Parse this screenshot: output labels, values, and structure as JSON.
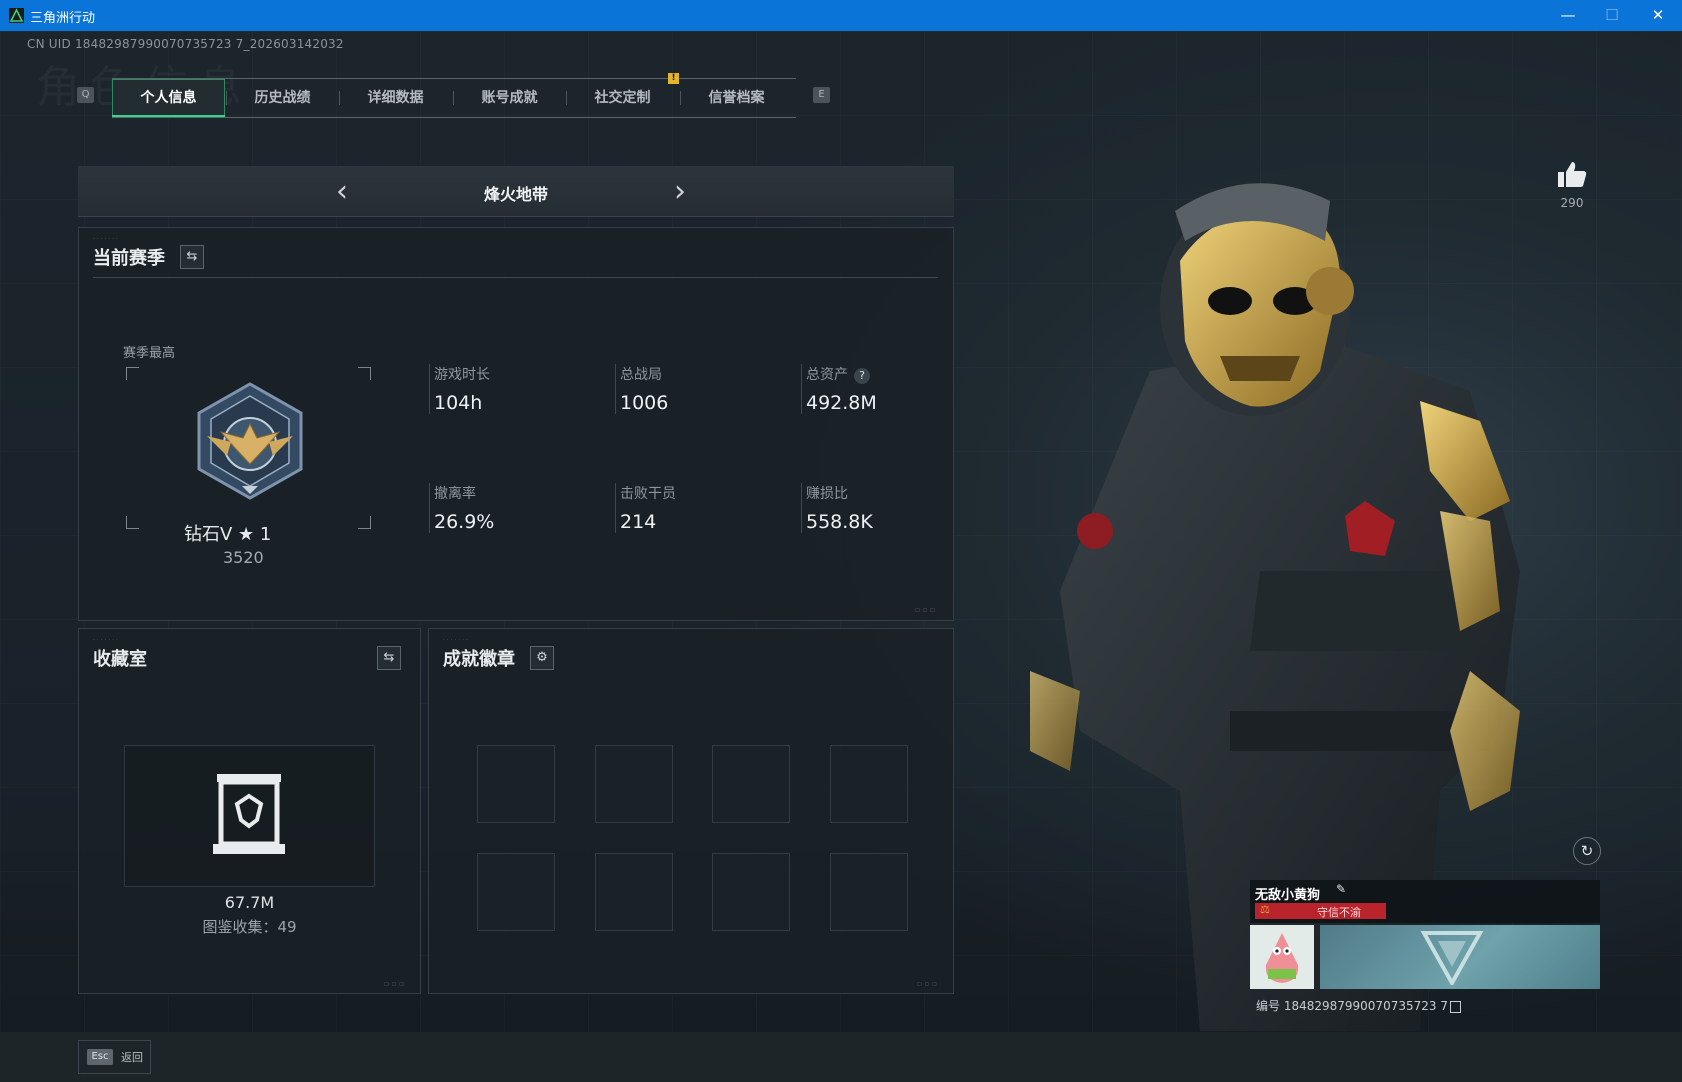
{
  "window": {
    "title": "三角洲行动",
    "controls": {
      "minimize": "—",
      "maximize": "☐",
      "close": "✕"
    }
  },
  "header": {
    "uid_line": "CN UID 18482987990070735723 7_202603142032",
    "ghost_title": "角色信息"
  },
  "tabs": {
    "left_key": "Q",
    "right_key": "E",
    "alert": "!",
    "items": [
      {
        "label": "个人信息",
        "active": true
      },
      {
        "label": "历史战绩",
        "active": false
      },
      {
        "label": "详细数据",
        "active": false
      },
      {
        "label": "账号成就",
        "active": false
      },
      {
        "label": "社交定制",
        "active": false
      },
      {
        "label": "信誉档案",
        "active": false
      }
    ]
  },
  "mode_selector": {
    "current": "烽火地带",
    "prev_icon": "chevron-left-icon",
    "next_icon": "chevron-right-icon"
  },
  "season": {
    "title": "当前赛季",
    "switch_icon": "swap-icon",
    "rank_label": "赛季最高",
    "rank_name": "钻石V ★ 1",
    "rank_score": "3520",
    "stats": [
      {
        "label": "游戏时长",
        "value": "104h"
      },
      {
        "label": "总战局",
        "value": "1006"
      },
      {
        "label": "总资产",
        "value": "492.8M",
        "help": "?"
      },
      {
        "label": "撤离率",
        "value": "26.9%"
      },
      {
        "label": "击败干员",
        "value": "214"
      },
      {
        "label": "赚损比",
        "value": "558.8K"
      }
    ]
  },
  "collection": {
    "title": "收藏室",
    "switch_icon": "swap-icon",
    "value": "67.7M",
    "count_line": "图鉴收集：49"
  },
  "badges": {
    "title": "成就徽章",
    "settings_icon": "gear-icon",
    "slots": 8
  },
  "profile": {
    "likes": "290",
    "player_name": "无敌小黄狗",
    "honor_title": "守信不渝",
    "player_id": "编号 18482987990070735723 7"
  },
  "footer": {
    "esc_key": "Esc",
    "back_label": "返回"
  },
  "colors": {
    "titlebar": "#0a74d9",
    "accent_green": "#38d48c",
    "honor_red": "#b8232c",
    "alert_yellow": "#e3b52c"
  }
}
